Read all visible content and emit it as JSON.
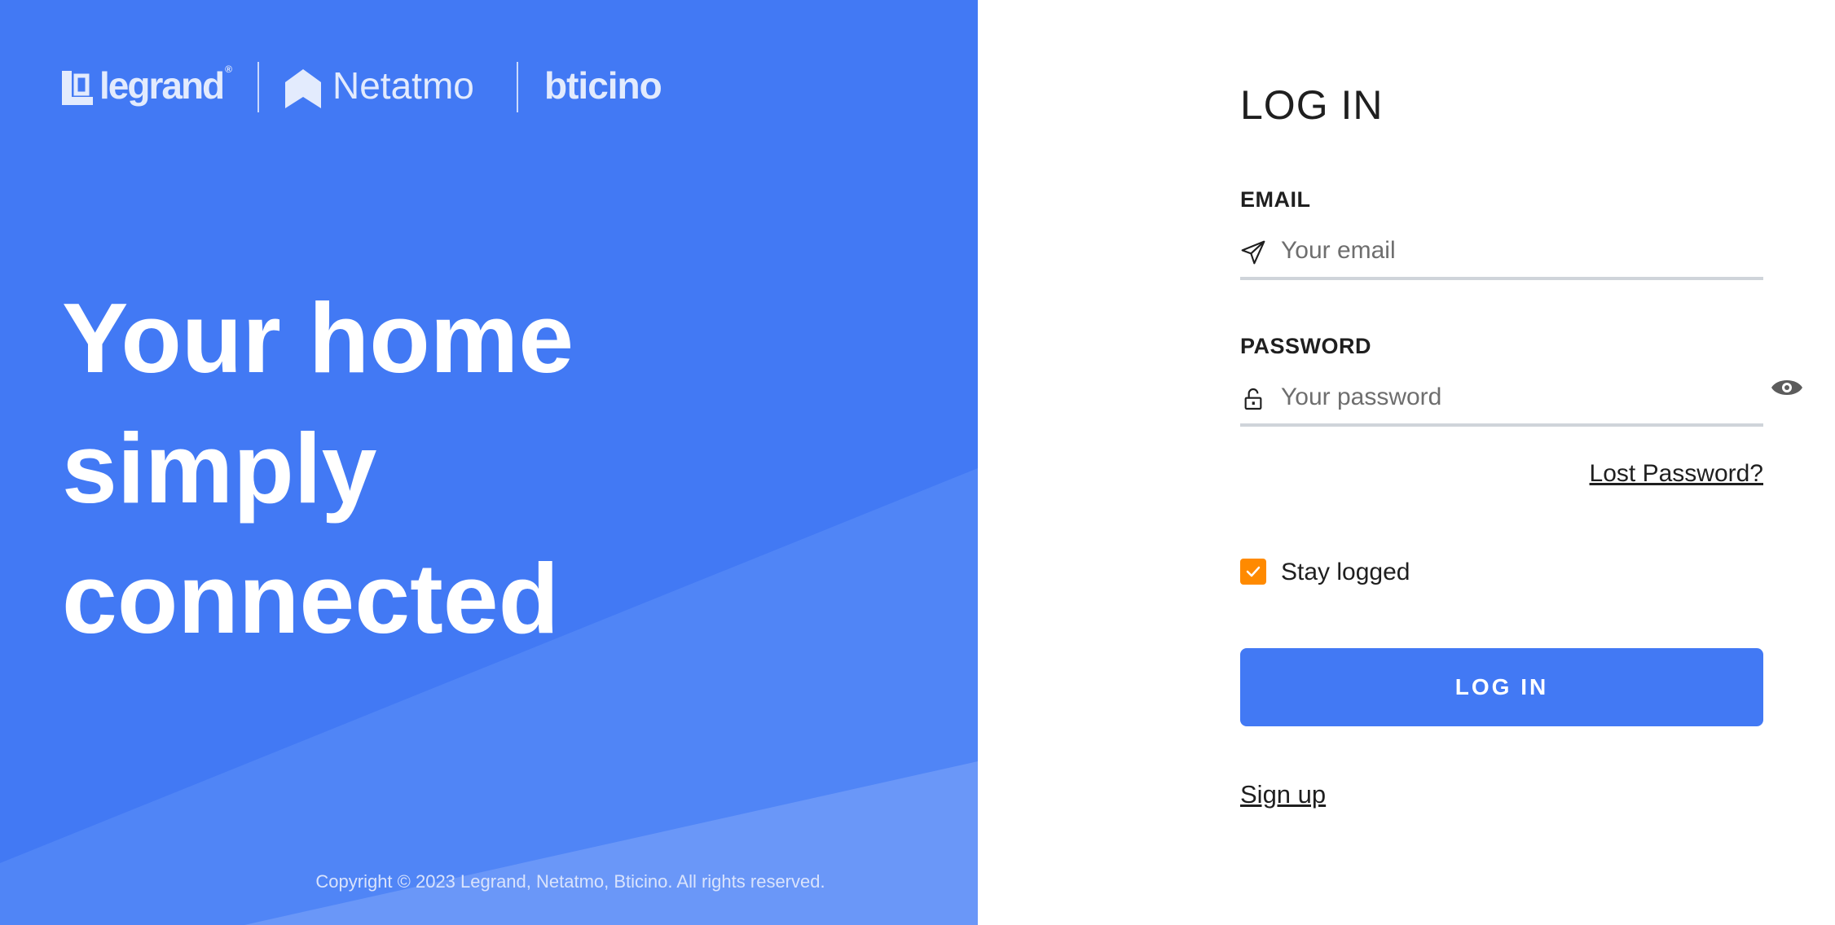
{
  "brand": {
    "legrand": "legrand",
    "legrand_reg": "®",
    "netatmo": "Netatmo",
    "bticino": "bticino"
  },
  "hero": {
    "line1": "Your home",
    "line2": "simply",
    "line3": "connected"
  },
  "footer": {
    "copyright": "Copyright © 2023 Legrand, Netatmo, Bticino. All rights reserved."
  },
  "login": {
    "title": "LOG IN",
    "email_label": "EMAIL",
    "email_placeholder": "Your email",
    "email_value": "",
    "email_icon": "paper-plane-icon",
    "password_label": "PASSWORD",
    "password_placeholder": "Your password",
    "password_value": "",
    "password_icon": "lock-icon",
    "show_password_icon": "eye-icon",
    "lost_password": "Lost Password?",
    "stay_logged": "Stay logged",
    "stay_logged_checked": true,
    "button": "LOG IN",
    "signup": "Sign up"
  },
  "colors": {
    "brand_blue": "#4279f4",
    "checkbox_orange": "#ff8a00",
    "text_dark": "#1f1f1f",
    "underline_gray": "#cfd4da"
  }
}
